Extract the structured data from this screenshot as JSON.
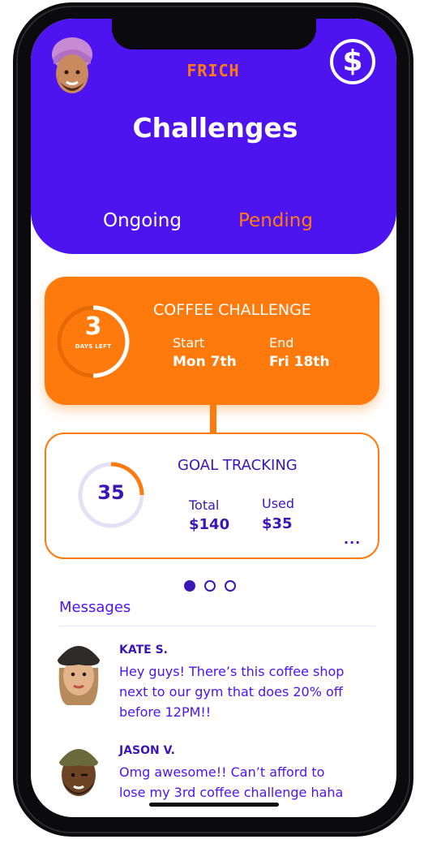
{
  "app": {
    "brand": "FRICH",
    "currency_icon": "dollar-icon",
    "accent": "#ff7a12",
    "primary": "#4d14f0"
  },
  "header": {
    "title": "Challenges"
  },
  "tabs": [
    {
      "label": "Ongoing",
      "active": true
    },
    {
      "label": "Pending",
      "active": false
    }
  ],
  "challenge": {
    "title": "COFFEE CHALLENGE",
    "days_left": "3",
    "days_left_label": "DAYS LEFT",
    "start_label": "Start",
    "start_value": "Mon 7th",
    "end_label": "End",
    "end_value": "Fri 18th"
  },
  "goal": {
    "title": "GOAL TRACKING",
    "value": "35",
    "total_label": "Total",
    "total_value": "$140",
    "used_label": "Used",
    "used_value": "$35",
    "more": "..."
  },
  "pager": {
    "count": 3,
    "active_index": 0
  },
  "messages": {
    "title": "Messages",
    "items": [
      {
        "name": "KATE S.",
        "lines": [
          "Hey guys! There’s this coffee shop",
          "next to our gym that does 20% off",
          "before 12PM!!"
        ]
      },
      {
        "name": "JASON V.",
        "lines": [
          "Omg awesome!! Can’t afford to",
          "lose my 3rd coffee challenge haha"
        ]
      }
    ]
  }
}
